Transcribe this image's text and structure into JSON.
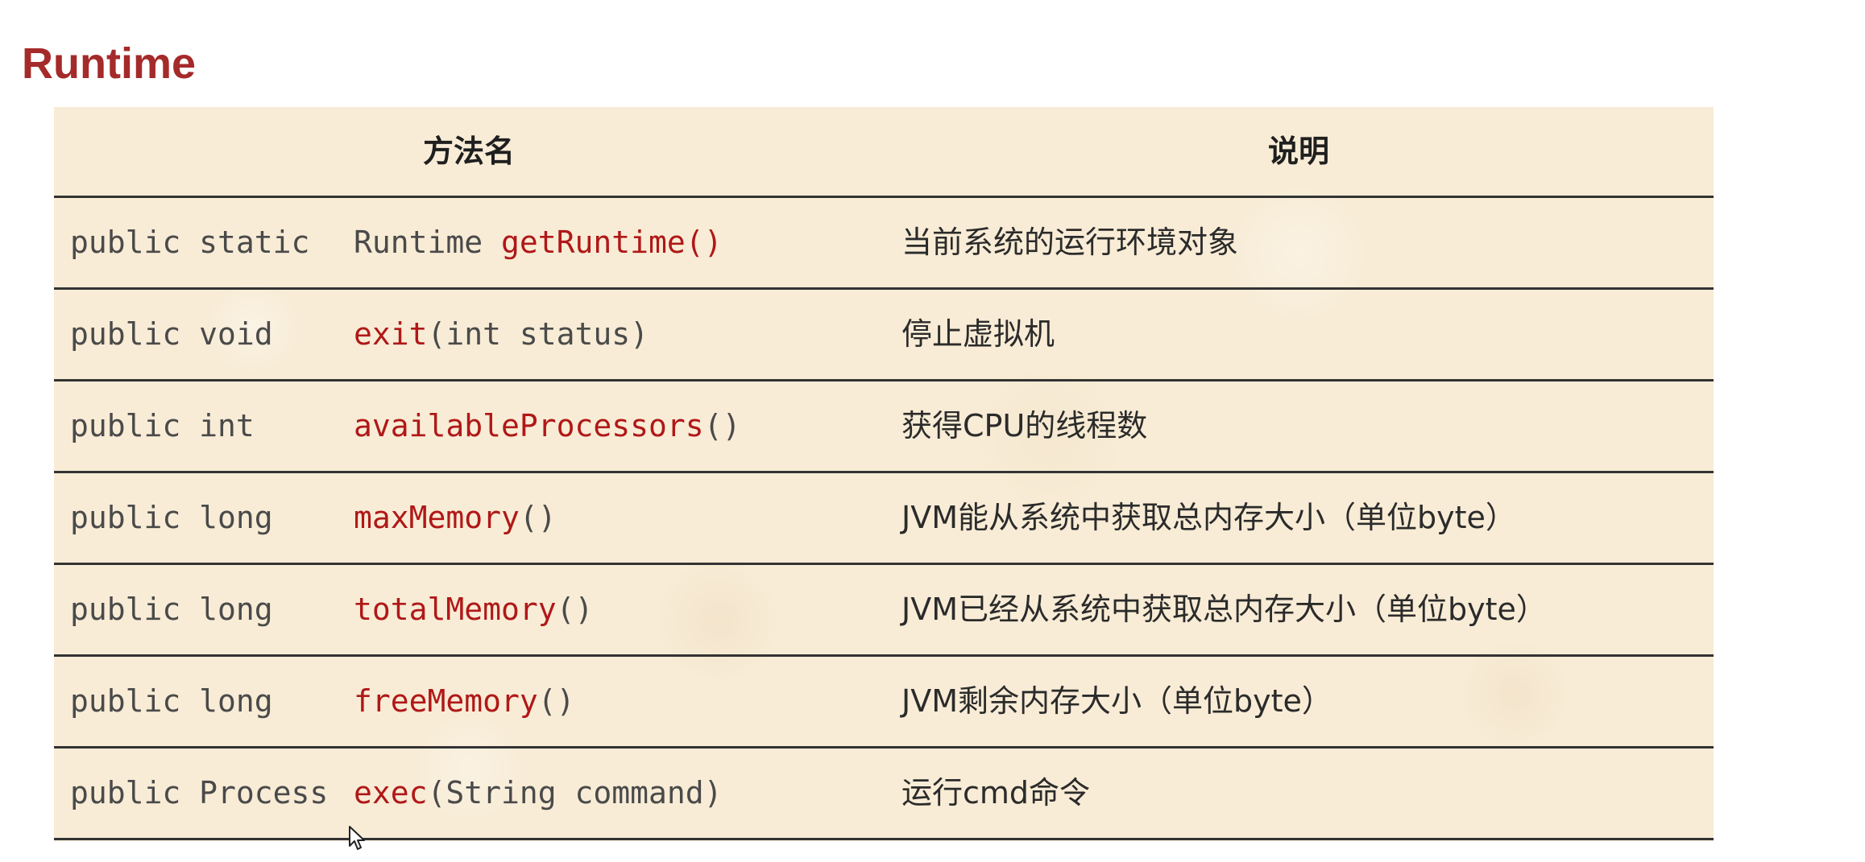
{
  "title": "Runtime",
  "table": {
    "headers": {
      "method": "方法名",
      "description": "说明"
    },
    "rows": [
      {
        "modifier": "public static",
        "return_type": "Runtime ",
        "name": "getRuntime",
        "params": "()",
        "params_red": true,
        "description": "当前系统的运行环境对象"
      },
      {
        "modifier": "public void",
        "return_type": "",
        "name": "exit",
        "params": "(int status)",
        "params_red": false,
        "description": "停止虚拟机"
      },
      {
        "modifier": "public int",
        "return_type": "",
        "name": "availableProcessors",
        "params": "()",
        "params_red": false,
        "description": "获得CPU的线程数"
      },
      {
        "modifier": "public long",
        "return_type": "",
        "name": "maxMemory",
        "params": "()",
        "params_red": false,
        "description": "JVM能从系统中获取总内存大小（单位byte）"
      },
      {
        "modifier": "public long",
        "return_type": "",
        "name": "totalMemory",
        "params": "()",
        "params_red": false,
        "description": "JVM已经从系统中获取总内存大小（单位byte）"
      },
      {
        "modifier": "public long",
        "return_type": "",
        "name": "freeMemory",
        "params": "()",
        "params_red": false,
        "description": "JVM剩余内存大小（单位byte）"
      },
      {
        "modifier": "public Process",
        "return_type": "",
        "name": "exec",
        "params": "(String command)",
        "params_red": false,
        "description": "运行cmd命令"
      }
    ]
  },
  "colors": {
    "title": "#a52a2a",
    "method_name": "#b01818",
    "table_background": "#f8ecd6",
    "rule": "#333333"
  },
  "icons": {
    "cursor": "mouse-pointer-icon"
  }
}
